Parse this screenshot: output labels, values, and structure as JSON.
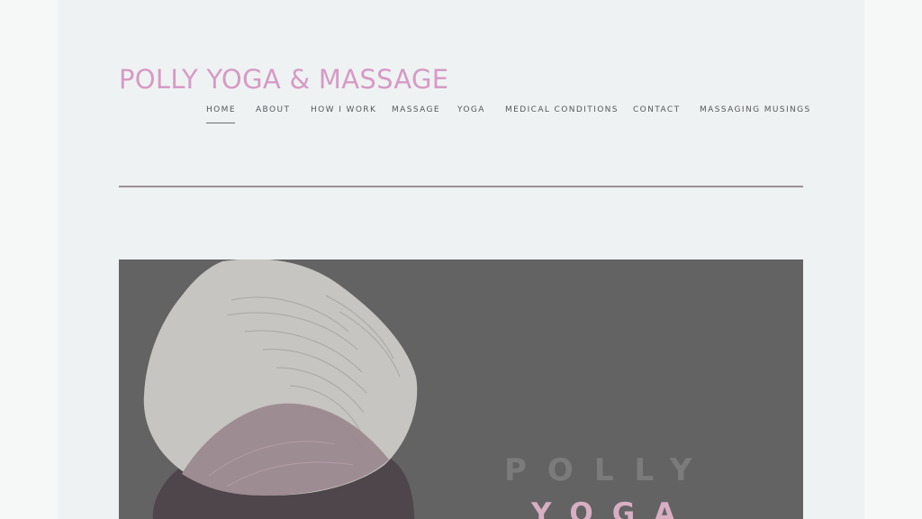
{
  "header": {
    "site_title": "POLLY YOGA & MASSAGE"
  },
  "nav": {
    "items": [
      {
        "label": "HOME",
        "active": true
      },
      {
        "label": "ABOUT"
      },
      {
        "label": "HOW I WORK"
      },
      {
        "label": "MASSAGE"
      },
      {
        "label": "YOGA"
      },
      {
        "label": "MEDICAL CONDITIONS"
      },
      {
        "label": "CONTACT"
      },
      {
        "label": "MASSAGING MUSINGS"
      }
    ]
  },
  "hero": {
    "line1": "POLLY",
    "line2": "YOGA"
  },
  "colors": {
    "brand": "#d69bc4",
    "hero_bg": "#636363",
    "stone_light": "#c7c5c1",
    "stone_dark": "#4e464a",
    "stone_overlap": "#9e8c93"
  }
}
